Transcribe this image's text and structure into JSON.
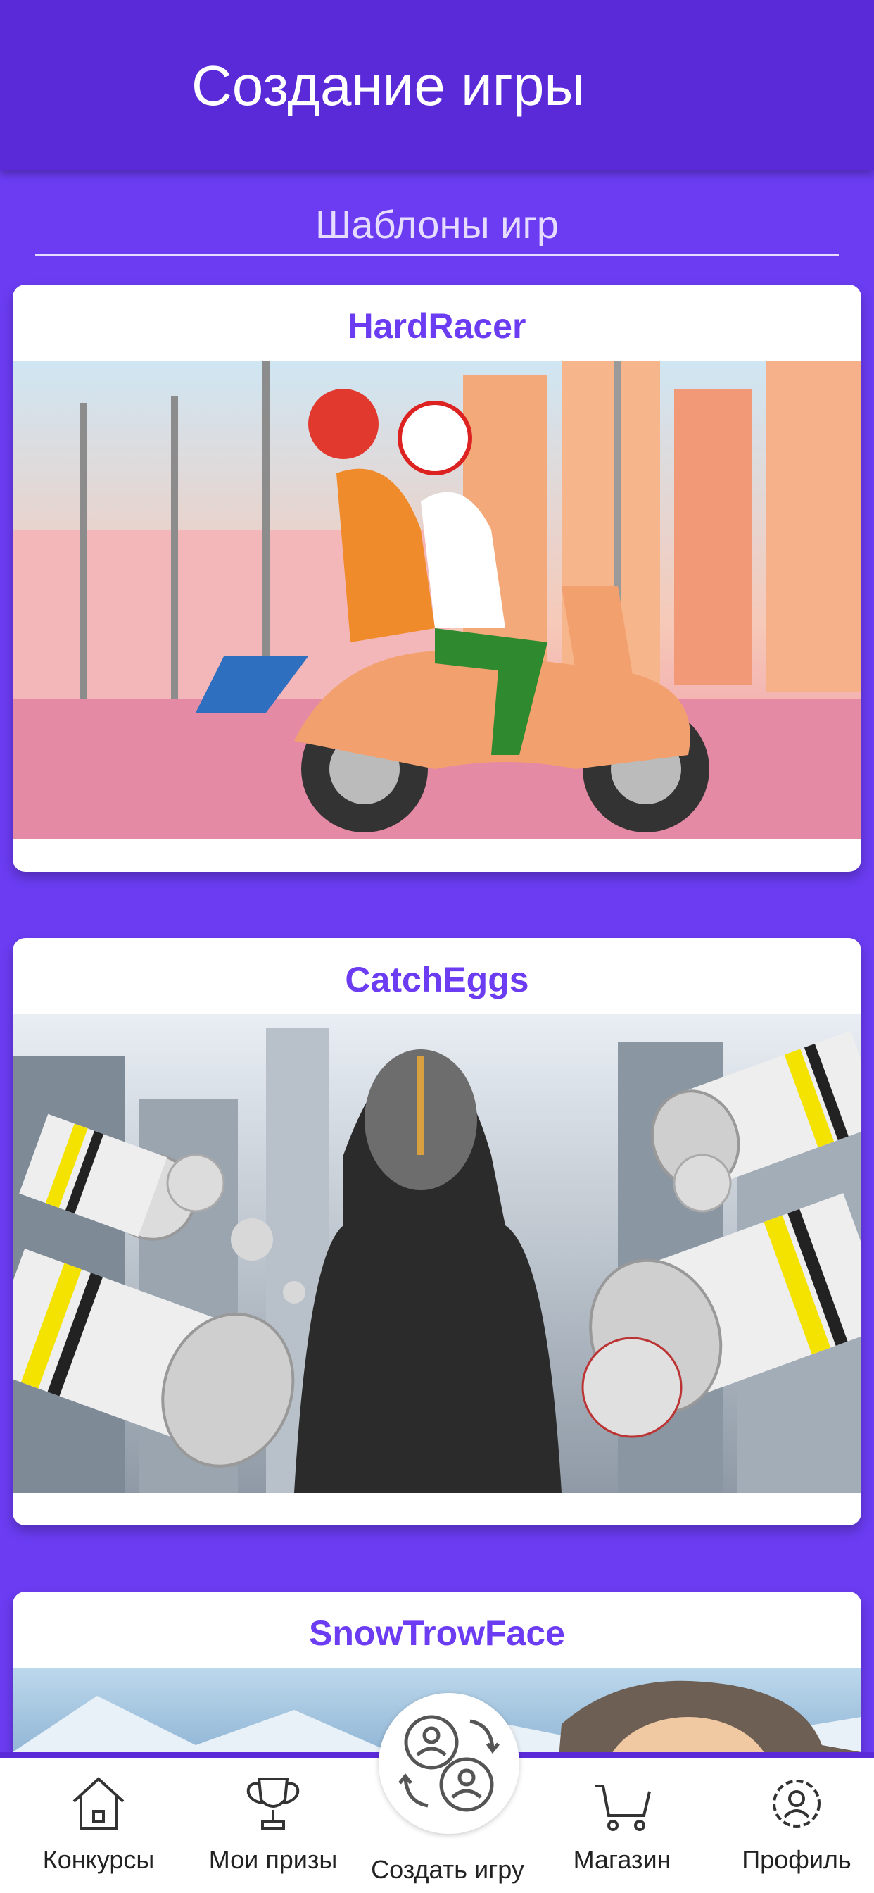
{
  "header": {
    "title": "Создание игры"
  },
  "section": {
    "title": "Шаблоны игр"
  },
  "cards": [
    {
      "title": "HardRacer"
    },
    {
      "title": "CatchEggs"
    },
    {
      "title": "SnowTrowFace"
    }
  ],
  "tabbar": {
    "items": [
      {
        "label": "Конкурсы",
        "icon": "house-icon"
      },
      {
        "label": "Мои призы",
        "icon": "trophy-icon"
      },
      {
        "label": "Создать игру",
        "icon": "create-game-icon"
      },
      {
        "label": "Магазин",
        "icon": "cart-icon"
      },
      {
        "label": "Профиль",
        "icon": "profile-gear-icon"
      }
    ]
  },
  "colors": {
    "accent": "#6b3cf2",
    "header": "#5a2ad8",
    "background": "#6b3cf2"
  }
}
